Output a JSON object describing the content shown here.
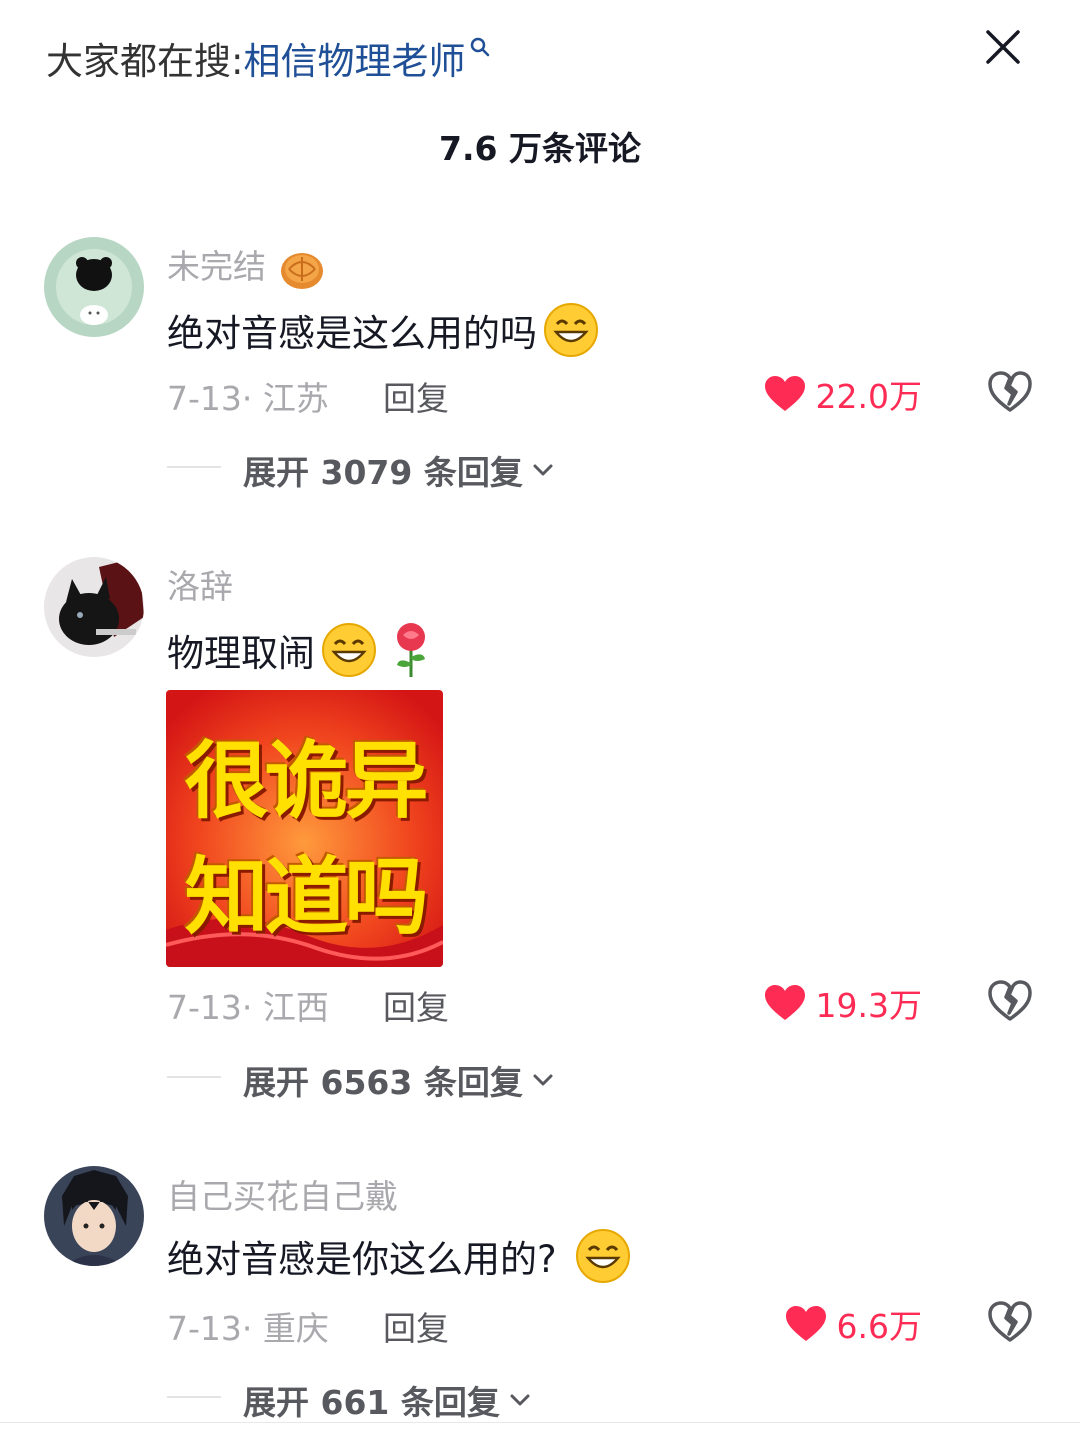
{
  "header": {
    "search_prefix": "大家都在搜:",
    "search_term": "相信物理老师",
    "comment_count": "7.6 万条评论"
  },
  "comments": [
    {
      "username": "未完结",
      "username_emoji": "mooncake",
      "text": "绝对音感是这么用的吗",
      "emojis": [
        "grin-face"
      ],
      "date": "7-13",
      "location": "江苏",
      "reply_label": "回复",
      "likes": "22.0万",
      "expand_label": "展开 3079 条回复"
    },
    {
      "username": "洛辞",
      "text": "物理取闹",
      "emojis": [
        "grin-face",
        "rose"
      ],
      "sticker": {
        "line1": "很诡异",
        "line2": "知道吗"
      },
      "date": "7-13",
      "location": "江西",
      "reply_label": "回复",
      "likes": "19.3万",
      "expand_label": "展开 6563 条回复"
    },
    {
      "username": "自己买花自己戴",
      "text": "绝对音感是你这么用的?",
      "emojis": [
        "grin-face"
      ],
      "date": "7-13",
      "location": "重庆",
      "reply_label": "回复",
      "likes": "6.6万",
      "expand_label": "展开 661 条回复"
    }
  ],
  "colors": {
    "like": "#fe2c55",
    "search_term": "#1f4f96",
    "muted": "#a8a8ad"
  }
}
